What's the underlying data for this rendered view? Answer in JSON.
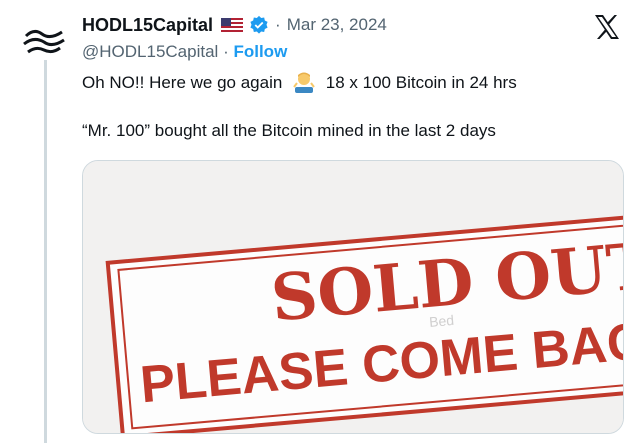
{
  "tweet": {
    "display_name": "HODL15Capital",
    "date": "Mar 23, 2024",
    "handle": "@HODL15Capital",
    "separator": "·",
    "follow_label": "Follow",
    "text_line1_before": "Oh NO!! Here we go again",
    "text_line1_after": "18 x 100 Bitcoin in 24 hrs",
    "text_line2": "“Mr. 100” bought all the Bitcoin mined in the last 2 days"
  },
  "media": {
    "stamp_line1": "SOLD OUT",
    "stamp_line2": "PLEASE COME BACK TOM",
    "watermark": "Bed"
  },
  "icons": {
    "avatar": "hodl-wave-logo",
    "flag": "us-flag-icon",
    "verified": "verified-badge-icon",
    "x": "x-logo-icon",
    "emoji": "man-shrugging-emoji"
  },
  "colors": {
    "accent": "#1d9bf0",
    "text": "#0f1419",
    "muted": "#536471",
    "stamp_red": "#c0392b"
  }
}
